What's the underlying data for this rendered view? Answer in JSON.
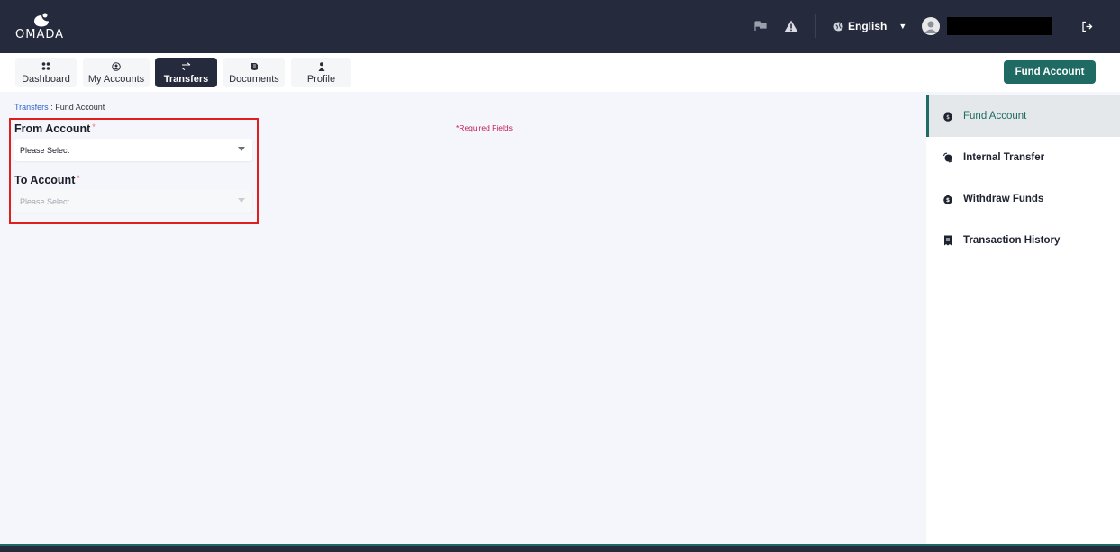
{
  "brand": {
    "name": "OMADA"
  },
  "topbar": {
    "language": "English"
  },
  "nav": {
    "tabs": [
      {
        "label": "Dashboard",
        "icon": "grid-icon"
      },
      {
        "label": "My Accounts",
        "icon": "user-circle-icon"
      },
      {
        "label": "Transfers",
        "icon": "transfer-arrows-icon",
        "active": true
      },
      {
        "label": "Documents",
        "icon": "documents-icon"
      },
      {
        "label": "Profile",
        "icon": "person-icon"
      }
    ],
    "fund_button": "Fund Account"
  },
  "breadcrumb": {
    "parent": "Transfers",
    "separator": " : ",
    "current": "Fund Account"
  },
  "form": {
    "required_note": "*Required Fields",
    "from": {
      "label": "From Account",
      "star": "*",
      "value": "Please Select"
    },
    "to": {
      "label": "To Account",
      "star": "*",
      "value": "Please Select"
    }
  },
  "sidebar": {
    "items": [
      {
        "label": "Fund Account",
        "icon": "money-bag-icon",
        "active": true
      },
      {
        "label": "Internal Transfer",
        "icon": "exchange-icon"
      },
      {
        "label": "Withdraw Funds",
        "icon": "money-bag-icon"
      },
      {
        "label": "Transaction History",
        "icon": "receipt-icon"
      }
    ]
  },
  "colors": {
    "topbar": "#262a3d",
    "accent": "#1f6b63",
    "link": "#2f62c9",
    "required": "#c2185b",
    "highlight": "#e01e1e"
  }
}
